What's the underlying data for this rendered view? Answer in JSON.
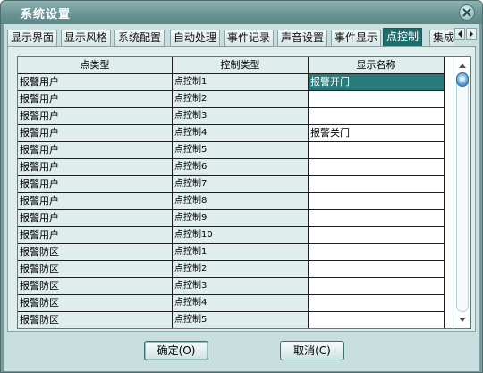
{
  "window": {
    "title": "系统设置"
  },
  "tabs": [
    {
      "label": "显示界面",
      "active": false
    },
    {
      "label": "显示风格",
      "active": false
    },
    {
      "label": "系统配置",
      "active": false
    },
    {
      "label": "自动处理",
      "active": false
    },
    {
      "label": "事件记录",
      "active": false
    },
    {
      "label": "声音设置",
      "active": false
    },
    {
      "label": "事件显示",
      "active": false
    },
    {
      "label": "点控制",
      "active": true
    },
    {
      "label": "集成",
      "active": false
    }
  ],
  "grid": {
    "headers": [
      "点类型",
      "控制类型",
      "显示名称"
    ],
    "rows": [
      [
        "报警用户",
        "点控制1",
        "报警开门"
      ],
      [
        "报警用户",
        "点控制2",
        ""
      ],
      [
        "报警用户",
        "点控制3",
        ""
      ],
      [
        "报警用户",
        "点控制4",
        "报警关门"
      ],
      [
        "报警用户",
        "点控制5",
        ""
      ],
      [
        "报警用户",
        "点控制6",
        ""
      ],
      [
        "报警用户",
        "点控制7",
        ""
      ],
      [
        "报警用户",
        "点控制8",
        ""
      ],
      [
        "报警用户",
        "点控制9",
        ""
      ],
      [
        "报警用户",
        "点控制10",
        ""
      ],
      [
        "报警防区",
        "点控制1",
        ""
      ],
      [
        "报警防区",
        "点控制2",
        ""
      ],
      [
        "报警防区",
        "点控制3",
        ""
      ],
      [
        "报警防区",
        "点控制4",
        ""
      ],
      [
        "报警防区",
        "点控制5",
        ""
      ]
    ],
    "selected_row": 0
  },
  "buttons": {
    "ok": "确定(O)",
    "cancel": "取消(C)"
  },
  "colors": {
    "active_tab": "#1f6e6e",
    "selected_cell": "#2a7b7b",
    "dialog_bg": "#c9dede"
  }
}
